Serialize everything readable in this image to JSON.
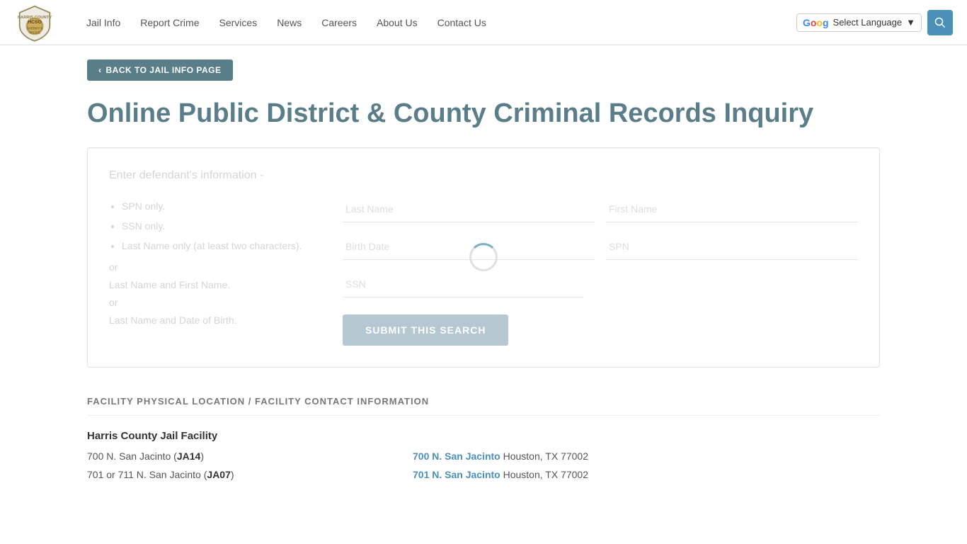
{
  "header": {
    "logo_alt": "Harris County Sheriff's Office",
    "nav_items": [
      {
        "label": "Jail Info",
        "href": "#"
      },
      {
        "label": "Report Crime",
        "href": "#"
      },
      {
        "label": "Services",
        "href": "#"
      },
      {
        "label": "News",
        "href": "#"
      },
      {
        "label": "Careers",
        "href": "#"
      },
      {
        "label": "About Us",
        "href": "#"
      },
      {
        "label": "Contact Us",
        "href": "#"
      }
    ],
    "translate_label": "Select Language",
    "search_aria": "Search"
  },
  "breadcrumb": {
    "back_label": "BACK TO JAIL INFO PAGE"
  },
  "page": {
    "title": "Online Public District & County Criminal Records Inquiry"
  },
  "form": {
    "header": "Enter defendant's information -",
    "instructions": {
      "items": [
        "SPN only.",
        "SSN only.",
        "Last Name only (at least two characters)."
      ],
      "extra": "or\nLast Name and First Name.\nor\nLast Name and Date of Birth."
    },
    "fields": {
      "last_name_placeholder": "Last Name",
      "first_name_placeholder": "First Name",
      "birth_date_placeholder": "Birth Date",
      "spn_placeholder": "SPN",
      "ssn_placeholder": "SSN"
    },
    "submit_label": "SUBMIT THIS SEARCH"
  },
  "facility": {
    "section_header": "FACILITY PHYSICAL LOCATION / FACILITY CONTACT INFORMATION",
    "name": "Harris County Jail Facility",
    "rows": [
      {
        "left_text": "700 N. San Jacinto (",
        "left_code": "JA14",
        "left_close": ")",
        "right_link": "700 N. San Jacinto",
        "right_text": " Houston, TX 77002"
      },
      {
        "left_text": "701 or 711 N. San Jacinto (",
        "left_code": "JA07",
        "left_close": ")",
        "right_link": "701 N. San Jacinto",
        "right_text": " Houston, TX 77002"
      }
    ]
  }
}
